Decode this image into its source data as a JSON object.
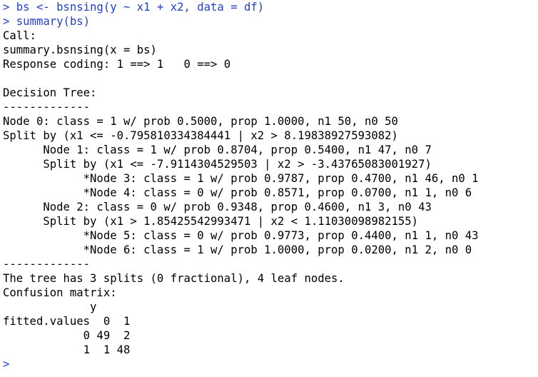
{
  "console": {
    "command_lines": [
      "> bs <- bsnsing(y ~ x1 + x2, data = df)",
      "> summary(bs)"
    ],
    "output_lines": [
      "Call:",
      "summary.bsnsing(x = bs)",
      "Response coding: 1 ==> 1   0 ==> 0",
      "",
      "Decision Tree:",
      "-------------",
      "Node 0: class = 1 w/ prob 0.5000, prop 1.0000, n1 50, n0 50",
      "Split by (x1 <= -0.795810334384441 | x2 > 8.19838927593082)",
      "      Node 1: class = 1 w/ prob 0.8704, prop 0.5400, n1 47, n0 7",
      "      Split by (x1 <= -7.9114304529503 | x2 > -3.43765083001927)",
      "            *Node 3: class = 1 w/ prob 0.9787, prop 0.4700, n1 46, n0 1",
      "            *Node 4: class = 0 w/ prob 0.8571, prop 0.0700, n1 1, n0 6",
      "      Node 2: class = 0 w/ prob 0.9348, prop 0.4600, n1 3, n0 43",
      "      Split by (x1 > 1.85425542993471 | x2 < 1.11030098982155)",
      "            *Node 5: class = 0 w/ prob 0.9773, prop 0.4400, n1 1, n0 43",
      "            *Node 6: class = 1 w/ prob 1.0000, prop 0.0200, n1 2, n0 0",
      "-------------",
      "The tree has 3 splits (0 fractional), 4 leaf nodes.",
      "Confusion matrix:",
      "             y",
      "fitted.values  0  1",
      "            0 49  2",
      "            1  1 48"
    ],
    "prompt": ">"
  },
  "colors": {
    "command": "#1f3fd1",
    "output": "#000000",
    "background": "#ffffff"
  }
}
